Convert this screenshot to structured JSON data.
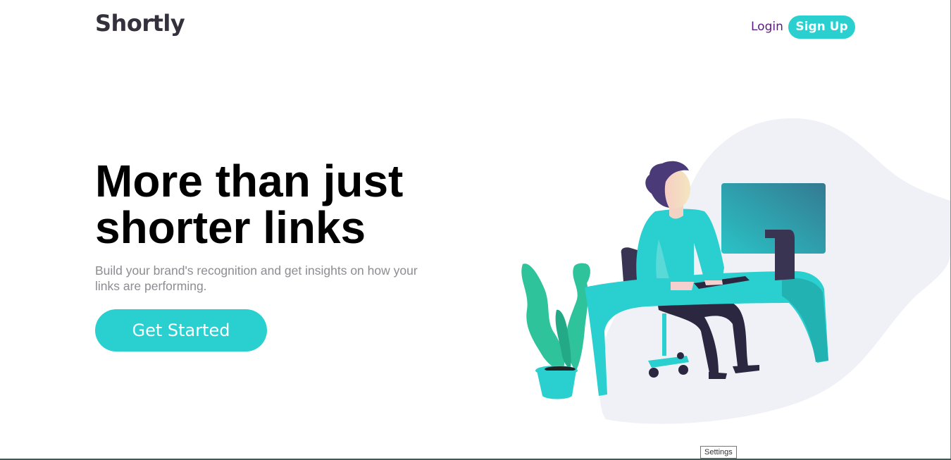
{
  "header": {
    "logo": "Shortly",
    "login_label": "Login",
    "signup_label": "Sign Up"
  },
  "hero": {
    "title_line1": "More than just",
    "title_line2": "shorter links",
    "subtitle": "Build your brand's recognition and get insights on how your links are performing.",
    "cta_label": "Get Started",
    "illustration": "person-working-at-desk-illustration"
  },
  "tooltip": {
    "text": "Settings"
  },
  "colors": {
    "primary": "#2acfcf",
    "dark_violet": "#34313d",
    "login": "#5c1a85",
    "gray_text": "#8c8c92",
    "blob": "#eff1f7"
  }
}
